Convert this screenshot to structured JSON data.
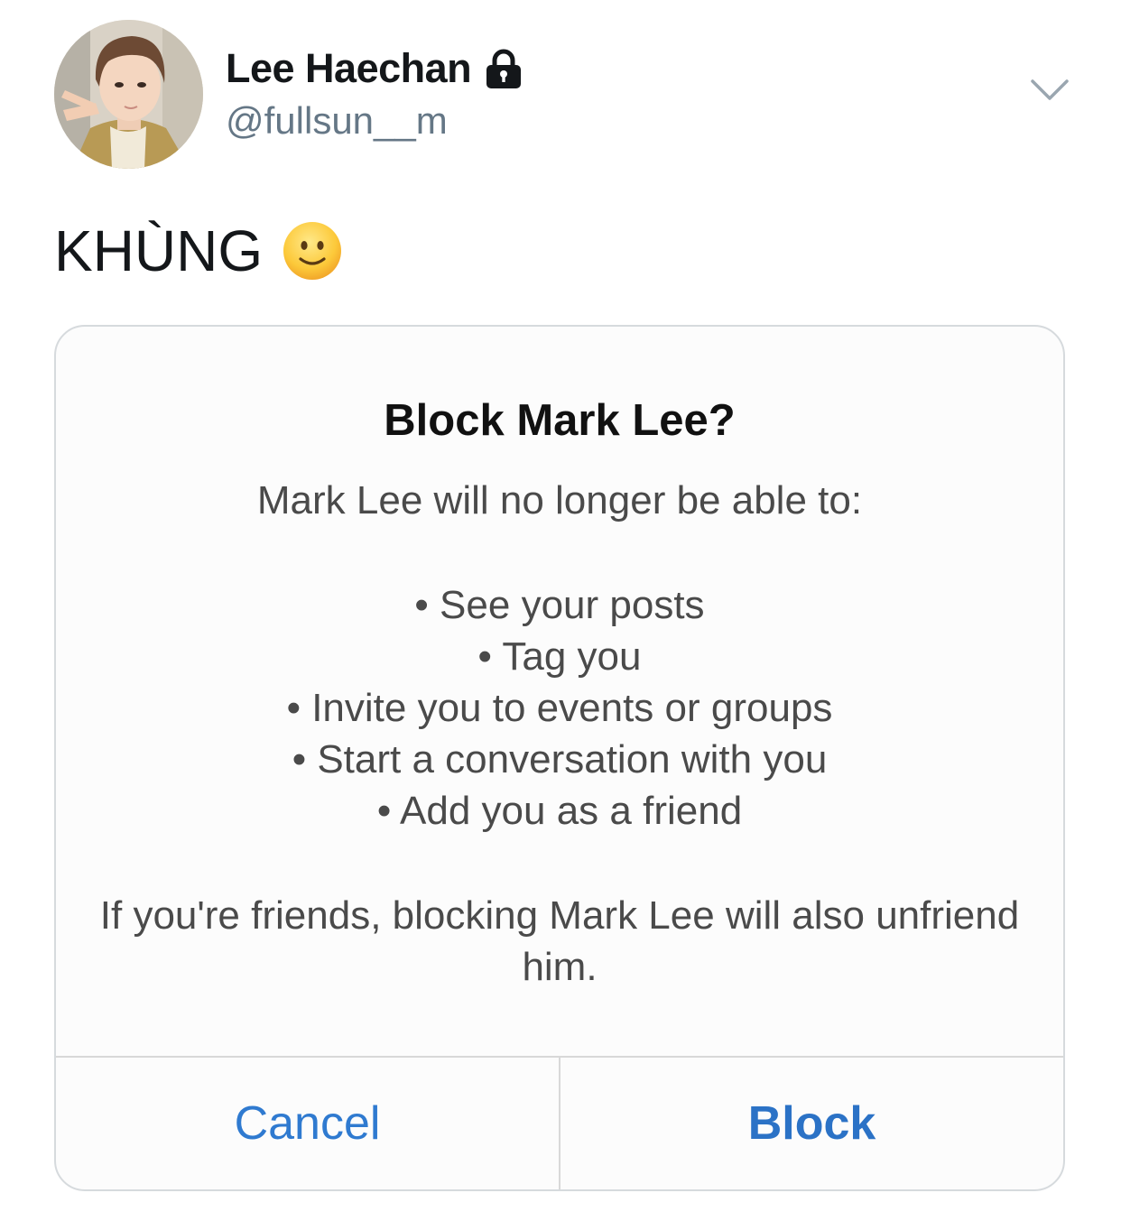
{
  "author": {
    "display_name": "Lee Haechan",
    "handle": "@fullsun__m",
    "protected_icon": "lock-icon",
    "avatar_icon": "profile-photo"
  },
  "tweet": {
    "text": "KHÙNG",
    "emoji_icon": "slightly-smiling-face-emoji"
  },
  "menu_icon": "chevron-down-icon",
  "dialog": {
    "title": "Block Mark Lee?",
    "intro": "Mark Lee will no longer be able to:",
    "items": [
      "• See your posts",
      "• Tag you",
      "• Invite you to events or groups",
      "• Start a conversation with you",
      "• Add you as a friend"
    ],
    "note": "If you're friends, blocking Mark Lee will also unfriend him.",
    "cancel_label": "Cancel",
    "block_label": "Block"
  },
  "colors": {
    "text_primary": "#14171a",
    "text_secondary": "#657786",
    "ios_blue": "#2f7ad0",
    "card_border": "#d6dadd"
  }
}
